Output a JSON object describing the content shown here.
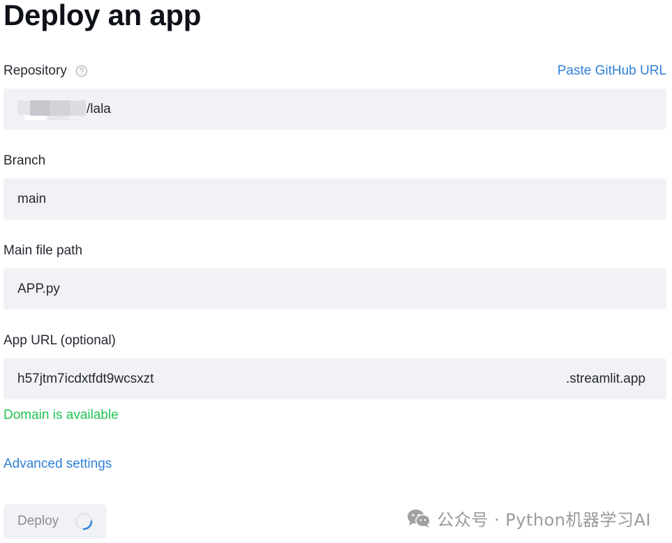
{
  "page": {
    "title": "Deploy an app"
  },
  "repository": {
    "label": "Repository",
    "help_icon": "question-circle-icon",
    "paste_link": "Paste GitHub URL",
    "value_suffix": "/lala"
  },
  "branch": {
    "label": "Branch",
    "value": "main"
  },
  "main_file": {
    "label": "Main file path",
    "value": "APP.py"
  },
  "app_url": {
    "label": "App URL (optional)",
    "value": "h57jtm7icdxtfdt9wcsxzt",
    "suffix": ".streamlit.app",
    "status": "Domain is available"
  },
  "advanced": {
    "label": "Advanced settings"
  },
  "deploy": {
    "label": "Deploy",
    "state": "loading"
  },
  "watermark": {
    "text": "公众号 · Python机器学习AI"
  },
  "colors": {
    "accent_link": "#2f80d6",
    "success": "#21c354",
    "field_bg": "#f0f2f6"
  }
}
